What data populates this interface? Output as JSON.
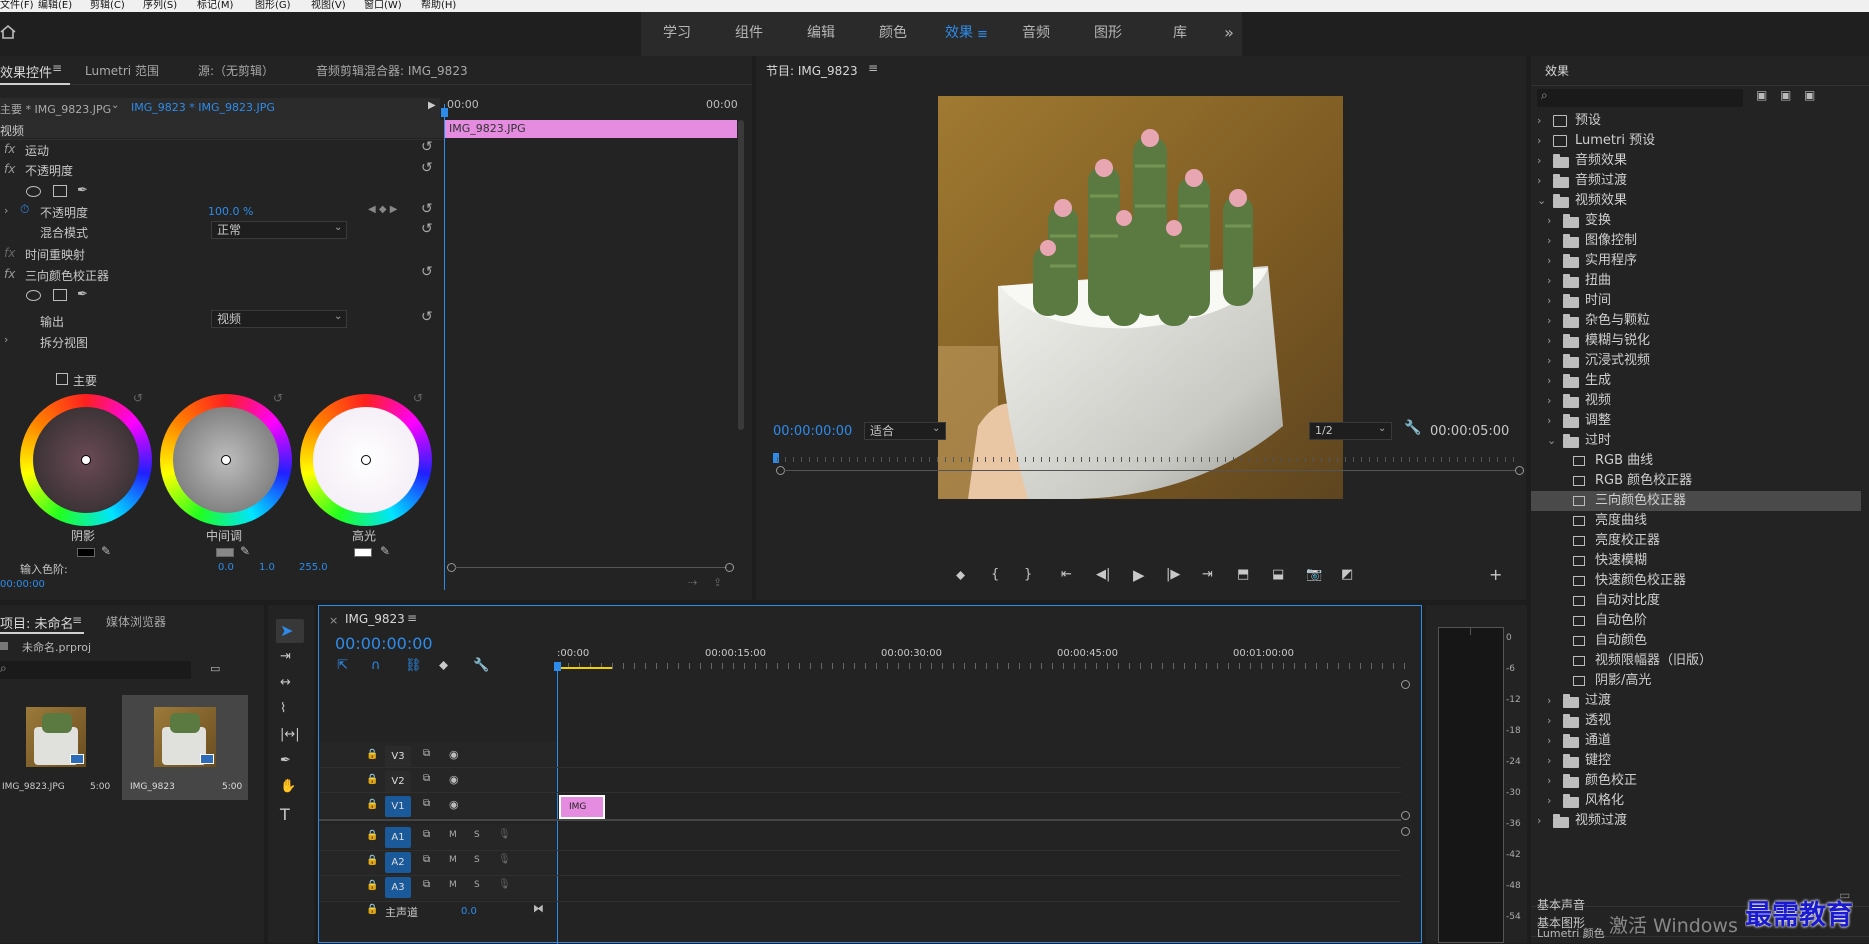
{
  "menu": [
    "文件(F)",
    "编辑(E)",
    "剪辑(C)",
    "序列(S)",
    "标记(M)",
    "图形(G)",
    "视图(V)",
    "窗口(W)",
    "帮助(H)"
  ],
  "workspaces": [
    "学习",
    "组件",
    "编辑",
    "颜色",
    "效果",
    "音频",
    "图形",
    "库"
  ],
  "workspace_more": "»",
  "effect_controls": {
    "tabs": [
      "效果控件",
      "Lumetri 范围",
      "源:（无剪辑）",
      "音频剪辑混合器: IMG_9823"
    ],
    "master_clip": "主要 * IMG_9823.JPG",
    "sequence_clip": "IMG_9823 * IMG_9823.JPG",
    "ruler_start": "00:00",
    "ruler_end": "00:00",
    "clip_bar": "IMG_9823.JPG",
    "section": "视频",
    "motion": "运动",
    "opacity_group": "不透明度",
    "opacity": "不透明度",
    "opacity_value": "100.0 %",
    "blend_mode": "混合模式",
    "blend_value": "正常",
    "time_remap": "时间重映射",
    "three_way": "三向颜色校正器",
    "output": "输出",
    "output_value": "视频",
    "split_view": "拆分视图",
    "master": "主要",
    "wheels": [
      "阴影",
      "中间调",
      "高光"
    ],
    "input_levels": "输入色阶:",
    "input_levels_values": [
      "0.0",
      "1.0",
      "255.0"
    ],
    "timecode": "00:00:00"
  },
  "program": {
    "title": "节目: IMG_9823",
    "timecode": "00:00:00:00",
    "fit": "适合",
    "quality": "1/2",
    "duration": "00:00:05:00"
  },
  "effects": {
    "title": "效果",
    "items": [
      {
        "label": "预设",
        "level": 0,
        "type": "preset",
        "open": false
      },
      {
        "label": "Lumetri 预设",
        "level": 0,
        "type": "preset",
        "open": false
      },
      {
        "label": "音频效果",
        "level": 0,
        "type": "folder",
        "open": false
      },
      {
        "label": "音频过渡",
        "level": 0,
        "type": "folder",
        "open": false
      },
      {
        "label": "视频效果",
        "level": 0,
        "type": "folder",
        "open": true
      },
      {
        "label": "变换",
        "level": 1,
        "type": "folder",
        "open": false
      },
      {
        "label": "图像控制",
        "level": 1,
        "type": "folder",
        "open": false
      },
      {
        "label": "实用程序",
        "level": 1,
        "type": "folder",
        "open": false
      },
      {
        "label": "扭曲",
        "level": 1,
        "type": "folder",
        "open": false
      },
      {
        "label": "时间",
        "level": 1,
        "type": "folder",
        "open": false
      },
      {
        "label": "杂色与颗粒",
        "level": 1,
        "type": "folder",
        "open": false
      },
      {
        "label": "模糊与锐化",
        "level": 1,
        "type": "folder",
        "open": false
      },
      {
        "label": "沉浸式视频",
        "level": 1,
        "type": "folder",
        "open": false
      },
      {
        "label": "生成",
        "level": 1,
        "type": "folder",
        "open": false
      },
      {
        "label": "视频",
        "level": 1,
        "type": "folder",
        "open": false
      },
      {
        "label": "调整",
        "level": 1,
        "type": "folder",
        "open": false
      },
      {
        "label": "过时",
        "level": 1,
        "type": "folder",
        "open": true
      },
      {
        "label": "RGB 曲线",
        "level": 2,
        "type": "effect"
      },
      {
        "label": "RGB 颜色校正器",
        "level": 2,
        "type": "effect"
      },
      {
        "label": "三向颜色校正器",
        "level": 2,
        "type": "effect",
        "selected": true
      },
      {
        "label": "亮度曲线",
        "level": 2,
        "type": "effect"
      },
      {
        "label": "亮度校正器",
        "level": 2,
        "type": "effect"
      },
      {
        "label": "快速模糊",
        "level": 2,
        "type": "effect"
      },
      {
        "label": "快速颜色校正器",
        "level": 2,
        "type": "effect"
      },
      {
        "label": "自动对比度",
        "level": 2,
        "type": "effect"
      },
      {
        "label": "自动色阶",
        "level": 2,
        "type": "effect"
      },
      {
        "label": "自动颜色",
        "level": 2,
        "type": "effect"
      },
      {
        "label": "视频限幅器（旧版）",
        "level": 2,
        "type": "effect"
      },
      {
        "label": "阴影/高光",
        "level": 2,
        "type": "effect"
      },
      {
        "label": "过渡",
        "level": 1,
        "type": "folder",
        "open": false
      },
      {
        "label": "透视",
        "level": 1,
        "type": "folder",
        "open": false
      },
      {
        "label": "通道",
        "level": 1,
        "type": "folder",
        "open": false
      },
      {
        "label": "键控",
        "level": 1,
        "type": "folder",
        "open": false
      },
      {
        "label": "颜色校正",
        "level": 1,
        "type": "folder",
        "open": false
      },
      {
        "label": "风格化",
        "level": 1,
        "type": "folder",
        "open": false
      },
      {
        "label": "视频过渡",
        "level": 0,
        "type": "folder",
        "open": false
      }
    ],
    "bottom": [
      "基本图形",
      "基本声音",
      "Lumetri 颜色"
    ]
  },
  "project": {
    "tabs": [
      "项目: 未命名",
      "媒体浏览器"
    ],
    "file": "未命名.prproj",
    "items": [
      {
        "name": "IMG_9823.JPG",
        "dur": "5:00"
      },
      {
        "name": "IMG_9823",
        "dur": "5:00"
      }
    ]
  },
  "timeline": {
    "title": "IMG_9823",
    "timecode": "00:00:00:00",
    "ruler": [
      ":00:00",
      "00:00:15:00",
      "00:00:30:00",
      "00:00:45:00",
      "00:01:00:00"
    ],
    "video_tracks": [
      "V3",
      "V2",
      "V1"
    ],
    "audio_tracks": [
      "A1",
      "A2",
      "A3"
    ],
    "master": "主声道",
    "master_value": "0.0",
    "clip": "IMG",
    "mute": "M",
    "solo": "S"
  },
  "meter": {
    "labels": [
      "0",
      "-6",
      "-12",
      "-18",
      "-24",
      "-30",
      "-36",
      "-42",
      "-48",
      "-54"
    ]
  },
  "watermark": {
    "win": "激活 Windows",
    "brand": "最需教育"
  }
}
